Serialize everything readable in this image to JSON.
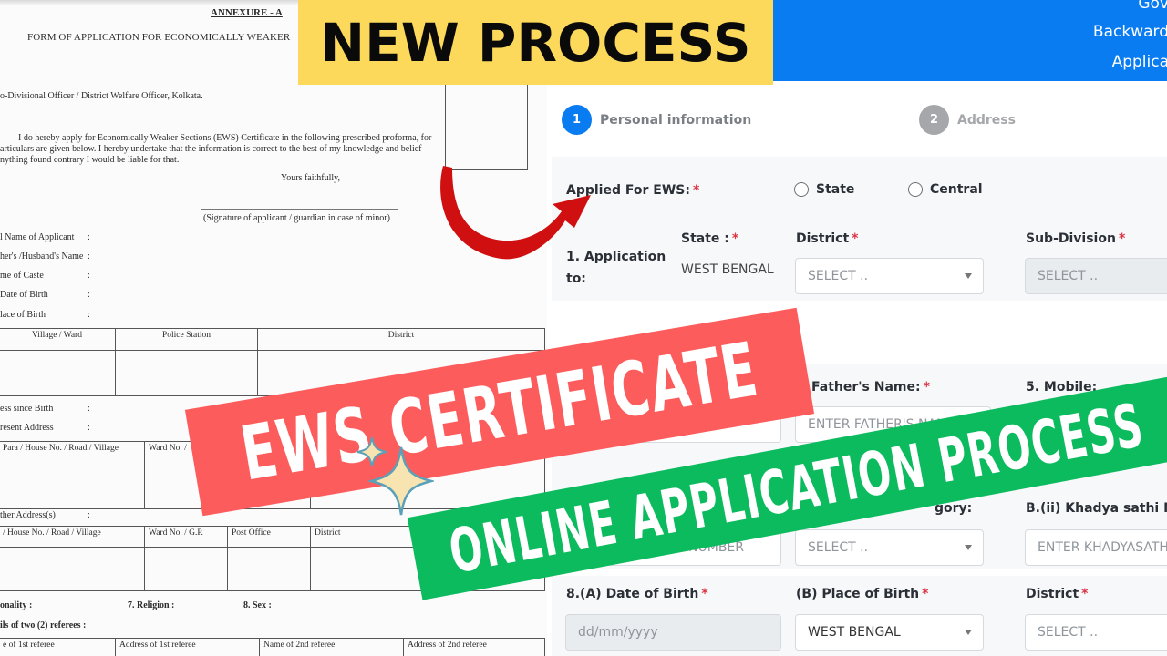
{
  "paper_form": {
    "annexure": "ANNEXURE - A",
    "title": "FORM OF APPLICATION FOR ECONOMICALLY WEAKER",
    "addressee": "o-Divisional Officer / District Welfare Officer, Kolkata.",
    "declaration_lines": [
      "        I do hereby apply for Economically Weaker Sections (EWS) Certificate in the following prescribed proforma, for",
      "articulars are given below. I hereby undertake that the information is correct to the best of my knowledge and belief",
      "nything found contrary I would be liable for that."
    ],
    "yours_faithfully": "Yours faithfully,",
    "signature_caption": "(Signature of applicant / guardian in case of minor)",
    "fields": [
      {
        "label": "l Name of Applicant",
        "colon": ":"
      },
      {
        "label": "her's /Husband's Name",
        "colon": ":"
      },
      {
        "label": "me of Caste",
        "colon": ":"
      },
      {
        "label": "Date of Birth",
        "colon": ":"
      },
      {
        "label": "lace of Birth",
        "colon": ":"
      }
    ],
    "birth_table_headers": [
      "Village / Ward",
      "Police Station",
      "District"
    ],
    "address_since_birth": "ess since Birth",
    "present_address": "resent Address",
    "present_table_headers": [
      "Para / House No. / Road / Village",
      "Ward No. /",
      "",
      ""
    ],
    "other_addresses": "ther Address(s)",
    "other_table_headers": [
      "/ House No. / Road / Village",
      "Ward No. / G.P.",
      "Post Office",
      "District"
    ],
    "nationality": "onality :",
    "religion": "7. Religion :",
    "sex": "8. Sex :",
    "referees_label": "ils of two (2) referees  :",
    "referee_headers": [
      "e of 1st referee",
      "Address of 1st referee",
      "Name of 2nd referee",
      "Address of 2nd referee"
    ],
    "colon": ":"
  },
  "portal": {
    "header_lines": [
      "Gov",
      "Backward",
      "Applica"
    ],
    "steps": [
      {
        "number": "1",
        "label": "Personal information",
        "state": "active"
      },
      {
        "number": "2",
        "label": "Address",
        "state": "inactive"
      }
    ],
    "applied_for_ews": {
      "label": "Applied For EWS:",
      "required": "*",
      "options": [
        {
          "label": "State",
          "selected": false
        },
        {
          "label": "Central",
          "selected": false
        }
      ]
    },
    "application_to": {
      "label": "1. Application to:",
      "label_line1": "1. Application",
      "label_line2": "to:",
      "state_label": "State :",
      "state_value": "WEST BENGAL",
      "district_label": "District",
      "district_placeholder": "SELECT ..",
      "subdivision_label": "Sub-Division",
      "subdivision_placeholder": "SELECT .."
    },
    "fathers_name": {
      "label": "Father's Name:",
      "placeholder": "ENTER FATHER'S NAME"
    },
    "mobile": {
      "label": "5. Mobile:"
    },
    "aadhaar_number": {
      "placeholder_visible": "NUMBER"
    },
    "category": {
      "label_visible": "gory:",
      "placeholder": "SELECT .."
    },
    "khadya_sathi": {
      "label": "B.(ii) Khadya sathi No",
      "placeholder": "ENTER KHADYASATHI"
    },
    "date_of_birth": {
      "label": "8.(A) Date of Birth",
      "placeholder": "dd/mm/yyyy"
    },
    "place_of_birth": {
      "label": "(B) Place of Birth",
      "value": "WEST BENGAL"
    },
    "birth_district": {
      "label": "District",
      "placeholder": "SELECT .."
    },
    "required_mark": "*"
  },
  "overlays": {
    "new_process": "NEW PROCESS",
    "ews_certificate": "EWS CERTIFICATE",
    "online_application": "ONLINE APPLICATION PROCESS"
  },
  "colors": {
    "portal_blue": "#0a7cf2",
    "banner_yellow": "#fcd95b",
    "banner_red": "#fd5c5c",
    "banner_green": "#0dbb5f",
    "arrow_red": "#d01010",
    "required_red": "#dc3545"
  }
}
